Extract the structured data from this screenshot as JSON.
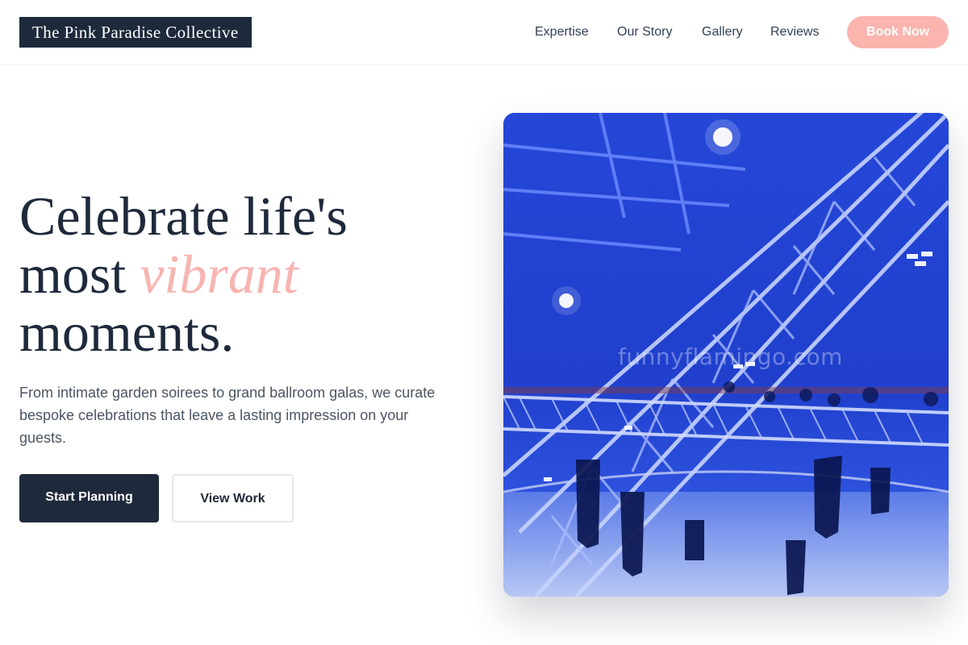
{
  "brand": {
    "name": "The Pink Paradise Collective"
  },
  "nav": {
    "links": [
      "Expertise",
      "Our Story",
      "Gallery",
      "Reviews"
    ],
    "cta_label": "Book Now"
  },
  "hero": {
    "headline_line1": "Celebrate life's",
    "headline_line2_prefix": "most ",
    "headline_accent": "vibrant",
    "headline_line3": "moments.",
    "subtext": "From intimate garden soirees to grand ballroom galas, we curate bespoke celebrations that leave a lasting impression on your guests.",
    "primary_button": "Start Planning",
    "secondary_button": "View Work",
    "image_watermark": "funnyflamingo.com"
  },
  "colors": {
    "navy": "#1e293b",
    "accent_pink": "#f8b4b1",
    "button_pink": "#fbb4ae",
    "stage_blue": "#1d3bc4"
  }
}
